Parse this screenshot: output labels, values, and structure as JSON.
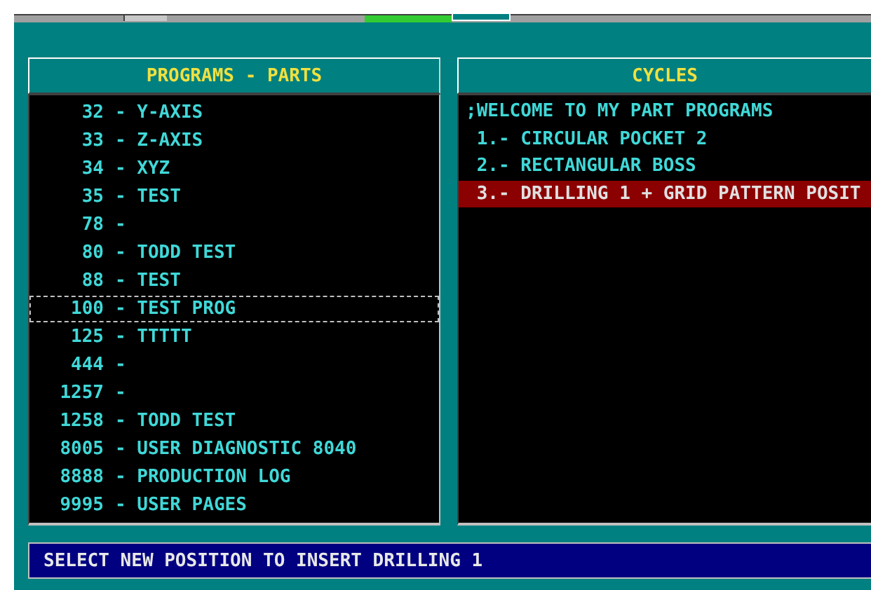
{
  "programs_panel": {
    "title": "PROGRAMS - PARTS",
    "items": [
      {
        "number": "32",
        "text": "- Y-AXIS",
        "focused": false
      },
      {
        "number": "33",
        "text": "- Z-AXIS",
        "focused": false
      },
      {
        "number": "34",
        "text": "- XYZ",
        "focused": false
      },
      {
        "number": "35",
        "text": "- TEST",
        "focused": false
      },
      {
        "number": "78",
        "text": "-",
        "focused": false
      },
      {
        "number": "80",
        "text": "- TODD TEST",
        "focused": false
      },
      {
        "number": "88",
        "text": "- TEST",
        "focused": false
      },
      {
        "number": "100",
        "text": "- TEST PROG",
        "focused": true
      },
      {
        "number": "125",
        "text": "- TTTTT",
        "focused": false
      },
      {
        "number": "444",
        "text": "-",
        "focused": false
      },
      {
        "number": "1257",
        "text": "-",
        "focused": false
      },
      {
        "number": "1258",
        "text": "- TODD TEST",
        "focused": false
      },
      {
        "number": "8005",
        "text": "- USER DIAGNOSTIC 8040",
        "focused": false
      },
      {
        "number": "8888",
        "text": "- PRODUCTION LOG",
        "focused": false
      },
      {
        "number": "9995",
        "text": "- USER PAGES",
        "focused": false
      }
    ]
  },
  "cycles_panel": {
    "title": "CYCLES",
    "items": [
      {
        "text": ";WELCOME TO MY PART PROGRAMS",
        "selected": false
      },
      {
        "text": " 1.- CIRCULAR POCKET 2",
        "selected": false
      },
      {
        "text": " 2.- RECTANGULAR BOSS",
        "selected": false
      },
      {
        "text": " 3.- DRILLING 1 + GRID PATTERN POSIT",
        "selected": true
      }
    ]
  },
  "status_bar": {
    "message": "SELECT NEW POSITION TO INSERT DRILLING 1"
  }
}
